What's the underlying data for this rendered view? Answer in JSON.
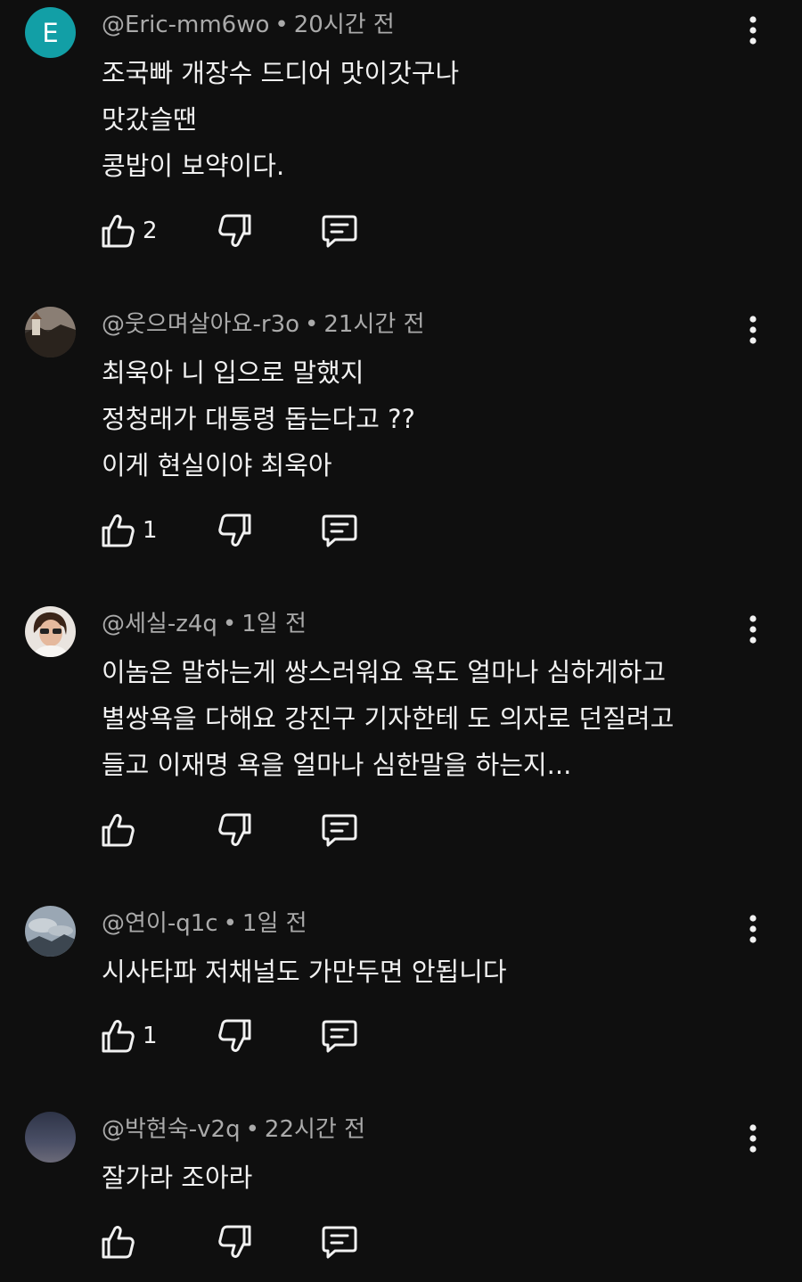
{
  "comments": [
    {
      "handle": "@Eric-mm6wo",
      "time": "20시간 전",
      "avatar_letter": "E",
      "avatar_color": "#129fa6",
      "lines": [
        "조국빠 개장수 드디어 맛이갓구나",
        "맛갔슬땐",
        "콩밥이 보약이다."
      ],
      "likes": "2"
    },
    {
      "handle": "@웃으며살아요-r3o",
      "time": "21시간 전",
      "avatar_letter": "",
      "lines": [
        "최욱아 니 입으로 말했지",
        "정청래가 대통령 돕는다고 ??",
        "이게 현실이야 최욱아"
      ],
      "likes": "1"
    },
    {
      "handle": "@세실-z4q",
      "time": "1일 전",
      "avatar_letter": "",
      "lines": [
        "이놈은 말하는게 쌍스러워요 욕도 얼마나 심하게하고",
        "별쌍욕을 다해요 강진구 기자한테 도 의자로 던질려고",
        "들고 이재명 욕을 얼마나 심한말을 하는지..."
      ],
      "likes": ""
    },
    {
      "handle": "@연이-q1c",
      "time": "1일 전",
      "avatar_letter": "",
      "lines": [
        "시사타파 저채널도 가만두면 안됩니다"
      ],
      "likes": "1"
    },
    {
      "handle": "@박현숙-v2q",
      "time": "22시간 전",
      "avatar_letter": "",
      "lines": [
        "잘가라 조아라"
      ],
      "likes": ""
    }
  ],
  "separator": "•",
  "icons": {
    "like": "thumbs-up-icon",
    "dislike": "thumbs-down-icon",
    "reply": "reply-icon",
    "menu": "more-vertical-icon"
  }
}
